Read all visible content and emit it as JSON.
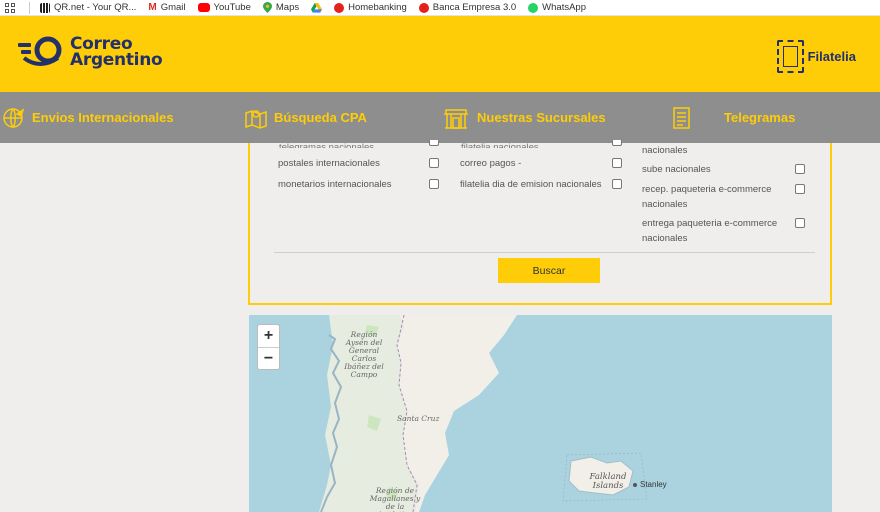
{
  "bookmarks": [
    {
      "label": "QR.net - Your QR...",
      "icon": "qr-icon",
      "color": "#222222"
    },
    {
      "label": "Gmail",
      "icon": "gmail-icon",
      "color": "#d93025"
    },
    {
      "label": "YouTube",
      "icon": "youtube-icon",
      "color": "#ff0000"
    },
    {
      "label": "Maps",
      "icon": "maps-pin-icon",
      "color": "#34a853"
    },
    {
      "label": "",
      "icon": "drive-icon",
      "color": "#4285f4"
    },
    {
      "label": "Homebanking",
      "icon": "bank-icon",
      "color": "#e2231a"
    },
    {
      "label": "Banca Empresa 3.0",
      "icon": "bank-icon",
      "color": "#e2231a"
    },
    {
      "label": "WhatsApp",
      "icon": "whatsapp-icon",
      "color": "#25d366"
    }
  ],
  "header": {
    "brand_line1": "Correo",
    "brand_line2": "Argentino",
    "filatelia_label": "Filatelia"
  },
  "nav": {
    "items": [
      {
        "label": "Envios Internacionales",
        "icon": "globe-plane-icon"
      },
      {
        "label": "Búsqueda CPA",
        "icon": "map-pin-icon"
      },
      {
        "label": "Nuestras Sucursales",
        "icon": "building-icon"
      },
      {
        "label": "Telegramas",
        "icon": "document-icon"
      }
    ]
  },
  "form": {
    "col1": [
      {
        "label": "telegramas nacionales",
        "checked": false
      },
      {
        "label": "postales internacionales",
        "checked": false
      },
      {
        "label": "monetarios internacionales",
        "checked": false
      }
    ],
    "col2": [
      {
        "label": "filatelia nacionales",
        "checked": false
      },
      {
        "label": "correo pagos -",
        "checked": false
      },
      {
        "label": "filatelia dia de emision nacionales",
        "checked": false
      }
    ],
    "col3": [
      {
        "label": "nacionales",
        "checked": false
      },
      {
        "label": "sube nacionales",
        "checked": false
      },
      {
        "label": "recep. paqueteria e-commerce nacionales",
        "checked": false
      },
      {
        "label": "entrega paqueteria e-commerce nacionales",
        "checked": false
      }
    ],
    "search_button": "Buscar"
  },
  "map": {
    "zoom_in": "+",
    "zoom_out": "−",
    "labels": {
      "region_aysen": "Región Aysén del General Carlos Ibáñez del Campo",
      "santa_cruz": "Santa Cruz",
      "falkland": "Falkland Islands",
      "stanley": "Stanley",
      "magallanes": "Región de Magallanes y de la Antártica"
    }
  },
  "colors": {
    "brand_yellow": "#fecd08",
    "brand_navy": "#23316b",
    "nav_gray": "#8e8e8e",
    "water": "#aad3df",
    "land": "#f2efe9"
  }
}
